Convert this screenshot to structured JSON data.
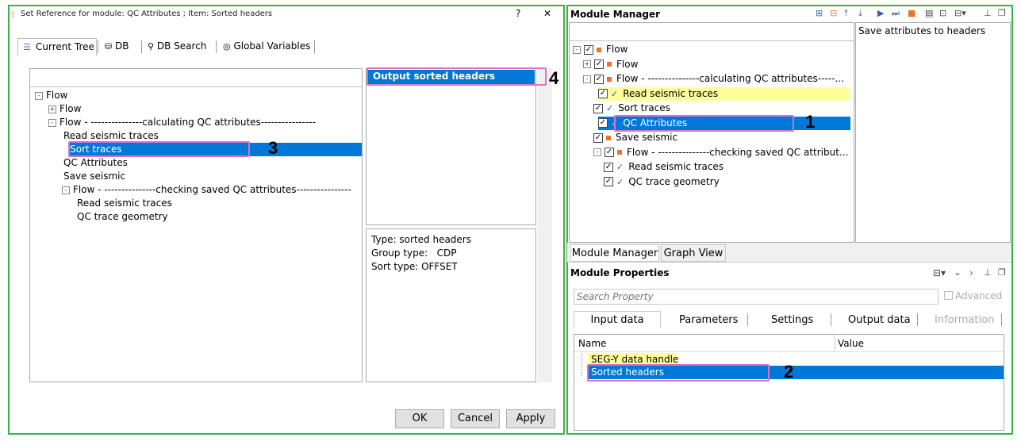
{
  "dialog": {
    "title": "Set Reference for module: QC Attributes ; Item: Sorted headers",
    "help_label": "?",
    "close_label": "✕",
    "tabs": [
      "Current Tree",
      "DB",
      "DB Search",
      "Global Variables"
    ],
    "tree": [
      {
        "label": "Flow",
        "level": 0,
        "pm": "-"
      },
      {
        "label": "Flow",
        "level": 1,
        "pm": "+"
      },
      {
        "label": "Flow - ---------------calculating QC attributes----------------",
        "level": 1,
        "pm": "-"
      },
      {
        "label": "Read seismic traces",
        "level": 2
      },
      {
        "label": "Sort traces",
        "level": 2,
        "selected": true
      },
      {
        "label": "QC Attributes",
        "level": 2
      },
      {
        "label": "Save seismic",
        "level": 2
      },
      {
        "label": "Flow - ---------------checking saved QC attributes----------------",
        "level": 2,
        "pm": "-"
      },
      {
        "label": "Read seismic traces",
        "level": 3
      },
      {
        "label": "QC trace geometry",
        "level": 3
      }
    ],
    "output_item": "Output sorted headers",
    "info_lines": [
      "Type: sorted headers",
      "Group type:   CDP",
      "Sort type: OFFSET"
    ],
    "buttons": {
      "ok": "OK",
      "cancel": "Cancel",
      "apply": "Apply"
    }
  },
  "module_manager": {
    "title": "Module Manager",
    "description": "Save attributes to headers",
    "tree": [
      {
        "label": "Flow",
        "level": 0,
        "pm": "-",
        "marker": "sq"
      },
      {
        "label": "Flow",
        "level": 1,
        "pm": "+",
        "marker": "sq"
      },
      {
        "label": "Flow - ---------------calculating QC attributes-----...",
        "level": 1,
        "pm": "-",
        "marker": "sq"
      },
      {
        "label": "Read seismic traces",
        "level": 2,
        "marker": "tick",
        "highlight": "yellow"
      },
      {
        "label": "Sort traces",
        "level": 2,
        "marker": "tick"
      },
      {
        "label": "QC Attributes",
        "level": 2,
        "marker": "tick",
        "highlight": "selected"
      },
      {
        "label": "Save seismic",
        "level": 2,
        "marker": "sq"
      },
      {
        "label": "Flow - ---------------checking saved QC attribut...",
        "level": 2,
        "pm": "-",
        "marker": "sq"
      },
      {
        "label": "Read seismic traces",
        "level": 3,
        "marker": "tick"
      },
      {
        "label": "QC trace geometry",
        "level": 3,
        "marker": "tick"
      }
    ],
    "view_tabs": [
      "Module Manager",
      "Graph View"
    ]
  },
  "module_properties": {
    "title": "Module Properties",
    "search_placeholder": "Search Property",
    "advanced_label": "Advanced",
    "tabs": [
      "Input data",
      "Parameters",
      "Settings",
      "Output data",
      "Information"
    ],
    "columns": [
      "Name",
      "Value"
    ],
    "rows": [
      {
        "name": "SEG-Y data handle",
        "highlight": "yellow"
      },
      {
        "name": "Sorted headers",
        "highlight": "selected"
      }
    ]
  },
  "callouts": [
    "1",
    "2",
    "3",
    "4"
  ],
  "colors": {
    "selection": "#0078d7",
    "highlight_border": "#d873c8",
    "frame": "#3cb04a",
    "yellow": "#ffff99",
    "flow_marker": "#e8742a"
  }
}
